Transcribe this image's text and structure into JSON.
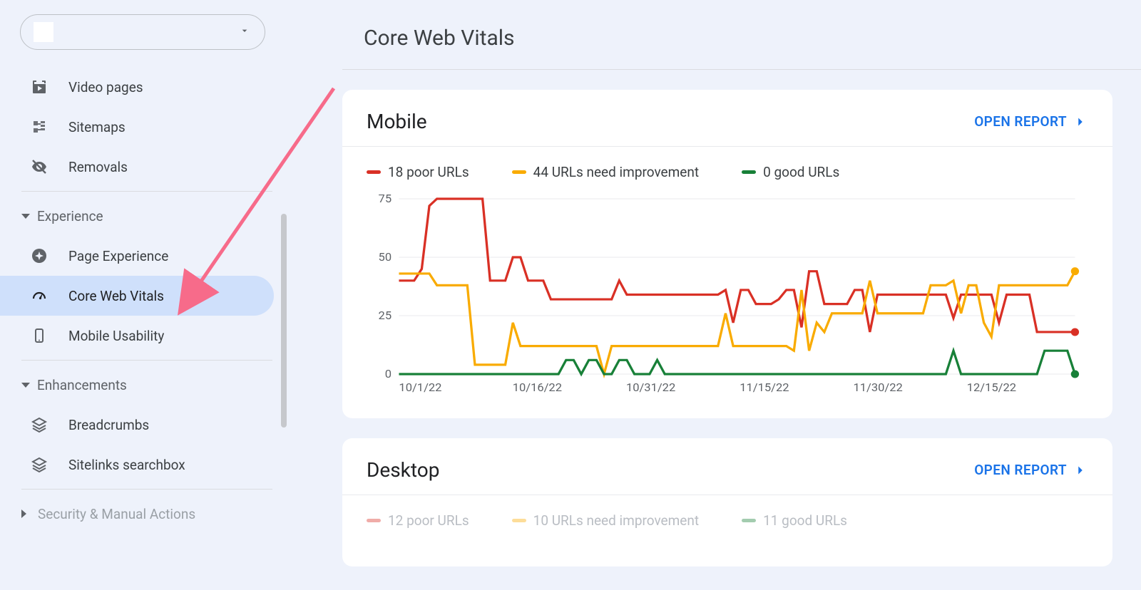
{
  "sidebar": {
    "items_top": [
      {
        "label": "Video pages",
        "icon": "video-pages-icon"
      },
      {
        "label": "Sitemaps",
        "icon": "sitemaps-icon"
      },
      {
        "label": "Removals",
        "icon": "removals-icon"
      }
    ],
    "section_experience": {
      "label": "Experience"
    },
    "experience_items": [
      {
        "label": "Page Experience",
        "icon": "page-experience-icon"
      },
      {
        "label": "Core Web Vitals",
        "icon": "speed-icon",
        "active": true
      },
      {
        "label": "Mobile Usability",
        "icon": "mobile-icon"
      }
    ],
    "section_enhancements": {
      "label": "Enhancements"
    },
    "enhancement_items": [
      {
        "label": "Breadcrumbs",
        "icon": "layers-icon"
      },
      {
        "label": "Sitelinks searchbox",
        "icon": "layers-icon"
      }
    ],
    "section_security": {
      "label": "Security & Manual Actions"
    }
  },
  "page": {
    "title": "Core Web Vitals",
    "open_report_label": "OPEN REPORT"
  },
  "mobile_card": {
    "title": "Mobile",
    "legend": {
      "poor": "18 poor URLs",
      "need": "44 URLs need improvement",
      "good": "0 good URLs"
    }
  },
  "desktop_card": {
    "title": "Desktop",
    "legend": {
      "poor": "12 poor URLs",
      "need": "10 URLs need improvement",
      "good": "11 good URLs"
    }
  },
  "colors": {
    "poor": "#d93025",
    "need": "#f9ab00",
    "good": "#188038",
    "link": "#1a73e8"
  },
  "chart_data": {
    "type": "line",
    "xlabel": "",
    "ylabel": "",
    "ylim": [
      0,
      75
    ],
    "y_ticks": [
      0,
      25,
      50,
      75
    ],
    "x_ticks": [
      "10/1/22",
      "10/16/22",
      "10/31/22",
      "11/15/22",
      "11/30/22",
      "12/15/22"
    ],
    "x": [
      0,
      1,
      2,
      3,
      4,
      5,
      6,
      7,
      8,
      9,
      10,
      11,
      12,
      13,
      14,
      15,
      16,
      17,
      18,
      19,
      20,
      21,
      22,
      23,
      24,
      25,
      26,
      27,
      28,
      29,
      30,
      31,
      32,
      33,
      34,
      35,
      36,
      37,
      38,
      39,
      40,
      41,
      42,
      43,
      44,
      45,
      46,
      47,
      48,
      49,
      50,
      51,
      52,
      53,
      54,
      55,
      56,
      57,
      58,
      59,
      60,
      61,
      62,
      63,
      64,
      65,
      66,
      67,
      68,
      69,
      70,
      71,
      72,
      73,
      74,
      75,
      76,
      77,
      78,
      79,
      80,
      81,
      82,
      83,
      84,
      85,
      86,
      87,
      88,
      89
    ],
    "series": [
      {
        "name": "poor URLs",
        "color": "#d93025",
        "values": [
          40,
          40,
          40,
          45,
          72,
          75,
          75,
          75,
          75,
          75,
          75,
          75,
          40,
          40,
          40,
          50,
          50,
          40,
          40,
          40,
          32,
          32,
          32,
          32,
          32,
          32,
          32,
          32,
          32,
          40,
          34,
          34,
          34,
          34,
          34,
          34,
          34,
          34,
          34,
          34,
          34,
          34,
          34,
          36,
          22,
          36,
          36,
          30,
          30,
          30,
          32,
          36,
          36,
          20,
          44,
          44,
          30,
          30,
          30,
          30,
          36,
          36,
          18,
          34,
          34,
          34,
          34,
          34,
          34,
          34,
          34,
          34,
          34,
          24,
          34,
          34,
          34,
          34,
          34,
          22,
          34,
          34,
          34,
          34,
          18,
          18,
          18,
          18,
          18,
          18
        ]
      },
      {
        "name": "need improvement URLs",
        "color": "#f9ab00",
        "values": [
          43,
          43,
          43,
          43,
          43,
          38,
          38,
          38,
          38,
          38,
          4,
          4,
          4,
          4,
          4,
          22,
          12,
          12,
          12,
          12,
          12,
          12,
          12,
          12,
          12,
          12,
          12,
          0,
          12,
          12,
          12,
          12,
          12,
          12,
          12,
          12,
          12,
          12,
          12,
          12,
          12,
          12,
          12,
          26,
          12,
          12,
          12,
          12,
          12,
          12,
          12,
          12,
          10,
          36,
          10,
          22,
          18,
          26,
          26,
          26,
          26,
          26,
          40,
          26,
          26,
          26,
          26,
          26,
          26,
          26,
          38,
          38,
          38,
          40,
          26,
          38,
          38,
          22,
          16,
          38,
          38,
          38,
          38,
          38,
          38,
          38,
          38,
          38,
          38,
          44
        ]
      },
      {
        "name": "good URLs",
        "color": "#188038",
        "values": [
          0,
          0,
          0,
          0,
          0,
          0,
          0,
          0,
          0,
          0,
          0,
          0,
          0,
          0,
          0,
          0,
          0,
          0,
          0,
          0,
          0,
          0,
          6,
          6,
          0,
          6,
          6,
          0,
          0,
          6,
          6,
          0,
          0,
          0,
          6,
          0,
          0,
          0,
          0,
          0,
          0,
          0,
          0,
          0,
          0,
          0,
          0,
          0,
          0,
          0,
          0,
          0,
          0,
          0,
          0,
          0,
          0,
          0,
          0,
          0,
          0,
          0,
          0,
          0,
          0,
          0,
          0,
          0,
          0,
          0,
          0,
          0,
          0,
          10,
          0,
          0,
          0,
          0,
          0,
          0,
          0,
          0,
          0,
          0,
          0,
          10,
          10,
          10,
          10,
          0
        ]
      }
    ]
  }
}
